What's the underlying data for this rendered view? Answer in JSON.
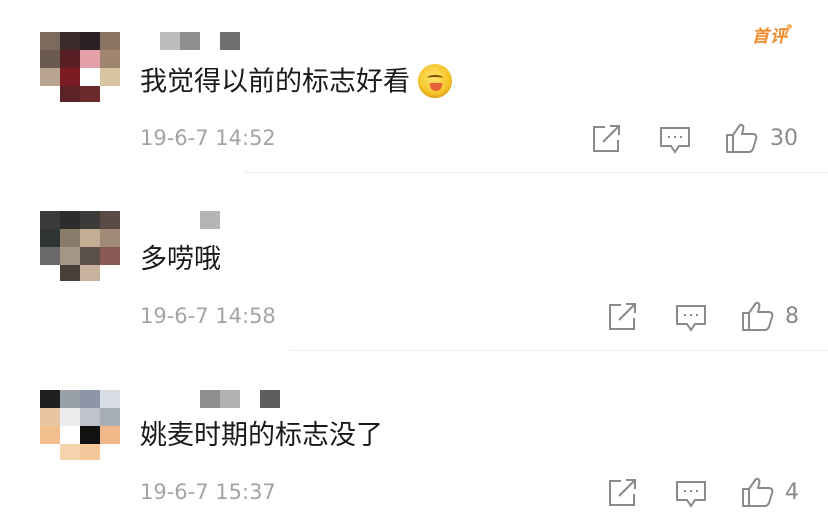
{
  "top_badge": "首评",
  "comments": [
    {
      "text": "我觉得以前的标志好看",
      "emoji": "yum-face-emoji",
      "time": "19-6-7 14:52",
      "likes": "30"
    },
    {
      "text": "多唠哦",
      "time": "19-6-7 14:58",
      "likes": "8"
    },
    {
      "text": "姚麦时期的标志没了",
      "time": "19-6-7 15:37",
      "likes": "4"
    }
  ],
  "icons": {
    "share": "share-icon",
    "reply": "comment-icon",
    "like": "thumbs-up-icon"
  },
  "colors": {
    "text": "#1a1a1a",
    "timestamp": "#a4a4a4",
    "icon": "#8a8a8a",
    "badge": "#f08a2c"
  }
}
